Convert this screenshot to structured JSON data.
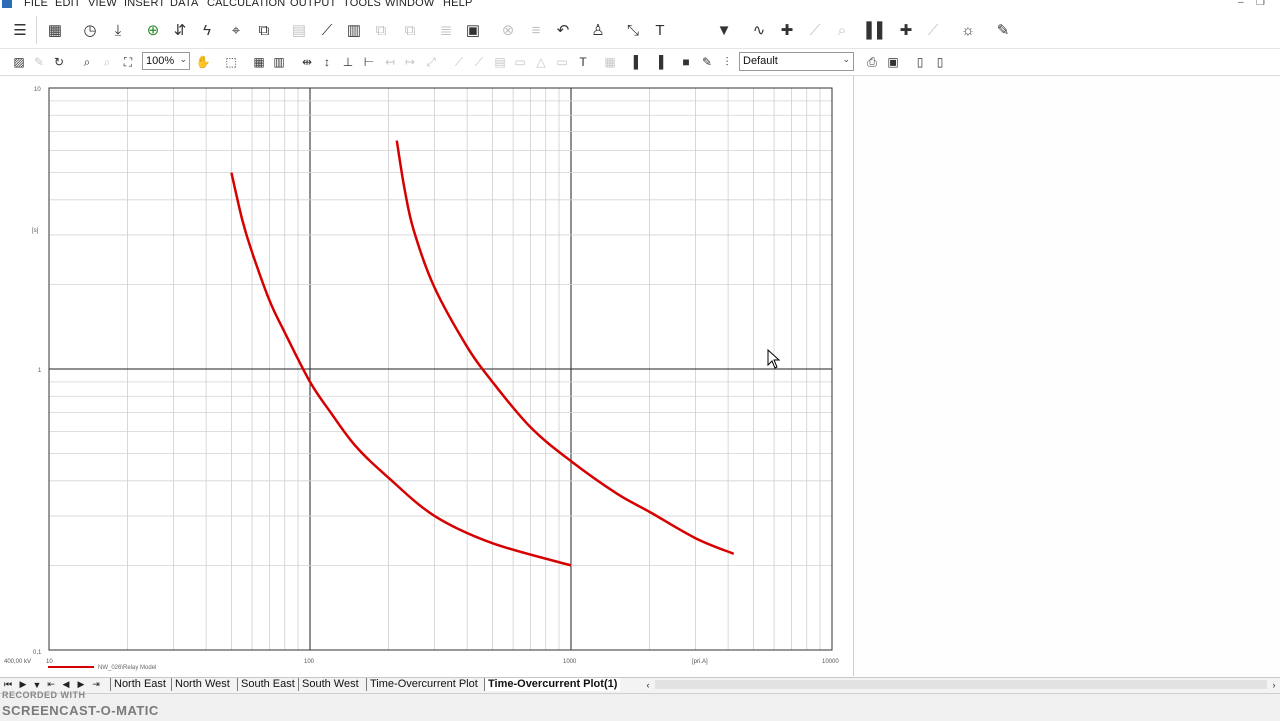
{
  "menubar": {
    "items": [
      "FILE",
      "EDIT",
      "VIEW",
      "INSERT",
      "DATA",
      "CALCULATION",
      "OUTPUT",
      "TOOLS",
      "WINDOW",
      "HELP"
    ]
  },
  "toolbar": {
    "zoom_value": "100%",
    "preset_value": "Default"
  },
  "plot": {
    "y_tick_labels": {
      "top": "10",
      "mid": "1",
      "bottom": "0,1"
    },
    "y_unit": "[s]",
    "x_tick_labels": [
      "10",
      "100",
      "1000",
      "10000"
    ],
    "x_unit": "[pri.A]",
    "voltage_label": "400,00 kV",
    "legend_label": "NW_026\\Relay Model"
  },
  "chart_data": {
    "type": "line",
    "x_scale": "log",
    "y_scale": "log",
    "xlim": [
      10,
      10000
    ],
    "ylim": [
      0.1,
      10
    ],
    "xlabel": "[pri.A]",
    "ylabel": "[s]",
    "grid": true,
    "legend": "bottom-left",
    "series": [
      {
        "name": "NW_026\\Relay Model",
        "color": "#d60000",
        "x": [
          50,
          55,
          60,
          70,
          80,
          100,
          120,
          150,
          200,
          300,
          500,
          1000
        ],
        "y": [
          5.0,
          3.4,
          2.6,
          1.75,
          1.35,
          0.9,
          0.7,
          0.53,
          0.41,
          0.3,
          0.24,
          0.2
        ]
      },
      {
        "name": "",
        "color": "#d60000",
        "x": [
          215,
          230,
          250,
          300,
          400,
          500,
          700,
          1000,
          1500,
          2000,
          3000,
          4200
        ],
        "y": [
          6.5,
          4.4,
          3.1,
          1.95,
          1.2,
          0.9,
          0.62,
          0.47,
          0.36,
          0.31,
          0.25,
          0.22
        ]
      }
    ]
  },
  "tabs": {
    "items": [
      "North East",
      "North West",
      "South East",
      "South West",
      "Time-Overcurrent Plot",
      "Time-Overcurrent Plot(1)"
    ],
    "active": "Time-Overcurrent Plot(1)"
  },
  "watermark": {
    "line1": "RECORDED WITH",
    "line2": "SCREENCAST-O-MATIC"
  }
}
